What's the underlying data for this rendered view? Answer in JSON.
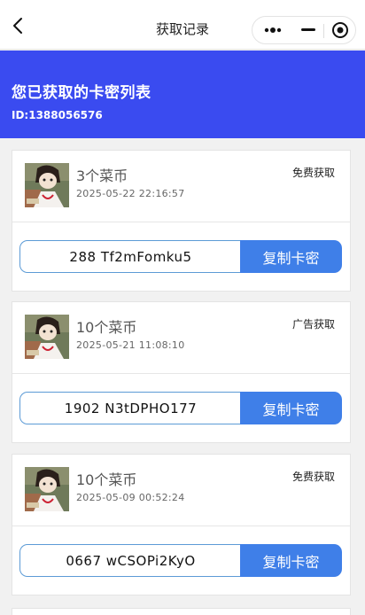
{
  "navbar": {
    "title": "获取记录",
    "back_icon": "chevron-left-icon",
    "capsule_icons": [
      "more-dots-icon",
      "minimize-icon",
      "close-circle-icon"
    ]
  },
  "header": {
    "title": "您已获取的卡密列表",
    "user_id": "ID:1388056576",
    "background": "#3a4bf0"
  },
  "records": [
    {
      "amount": "3个菜币",
      "time": "2025-05-22 22:16:57",
      "source": "免费获取",
      "code": "288 Tf2mFomku5",
      "copy_label": "复制卡密"
    },
    {
      "amount": "10个菜币",
      "time": "2025-05-21 11:08:10",
      "source": "广告获取",
      "code": "1902 N3tDPHO177",
      "copy_label": "复制卡密"
    },
    {
      "amount": "10个菜币",
      "time": "2025-05-09 00:52:24",
      "source": "免费获取",
      "code": "0667 wCSOPi2KyO",
      "copy_label": "复制卡密"
    }
  ],
  "colors": {
    "accent": "#3f7fe8",
    "code_border": "#5c9bd6"
  }
}
